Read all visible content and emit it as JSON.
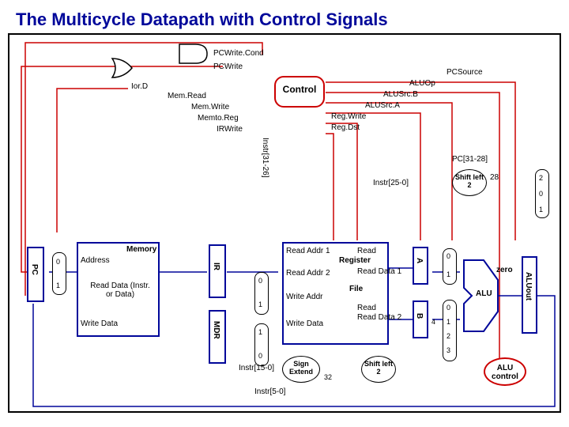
{
  "title": "The Multicycle Datapath with Control Signals",
  "control": {
    "label": "Control",
    "signals": {
      "pcWriteCond": "PCWrite.Cond",
      "pcWrite": "PCWrite",
      "iorD": "Ior.D",
      "memRead": "Mem.Read",
      "memWrite": "Mem.Write",
      "memtoReg": "Memto.Reg",
      "irWrite": "IRWrite",
      "pcSource": "PCSource",
      "aluOp": "ALUOp",
      "aluSrcB": "ALUSrc.B",
      "aluSrcA": "ALUSrc.A",
      "regWrite": "Reg.Write",
      "regDst": "Reg.Dst"
    }
  },
  "blocks": {
    "pc": "PC",
    "memory": "Memory",
    "ir": "IR",
    "mdr": "MDR",
    "regfile": {
      "title": "Register",
      "sub": "File"
    },
    "a": "A",
    "b": "B",
    "alu": "ALU",
    "aluout": "ALUout",
    "signExtend": "Sign Extend",
    "shiftLeft2a": "Shift left 2",
    "shiftLeft2b": "Shift left 2",
    "aluControl": "ALU control"
  },
  "ports": {
    "address": "Address",
    "readData": "Read Data (Instr. or Data)",
    "writeData": "Write Data",
    "readAddr1": "Read Addr 1",
    "readAddr2": "Read Addr 2",
    "writeAddr": "Write Addr",
    "writeData2": "Write Data",
    "readData1": "Read Data 1",
    "readData2": "Read Data 2",
    "zero": "zero"
  },
  "buses": {
    "instr3126": "Instr[31-26]",
    "pc3128": "PC[31-28]",
    "instr250": "Instr[25-0]",
    "instr150": "Instr[15-0]",
    "instr50": "Instr[5-0]",
    "width28": "28",
    "width32": "32"
  },
  "mux": {
    "m0": "0",
    "m1": "1",
    "m2": "2",
    "m3": "3",
    "m4": "4"
  }
}
